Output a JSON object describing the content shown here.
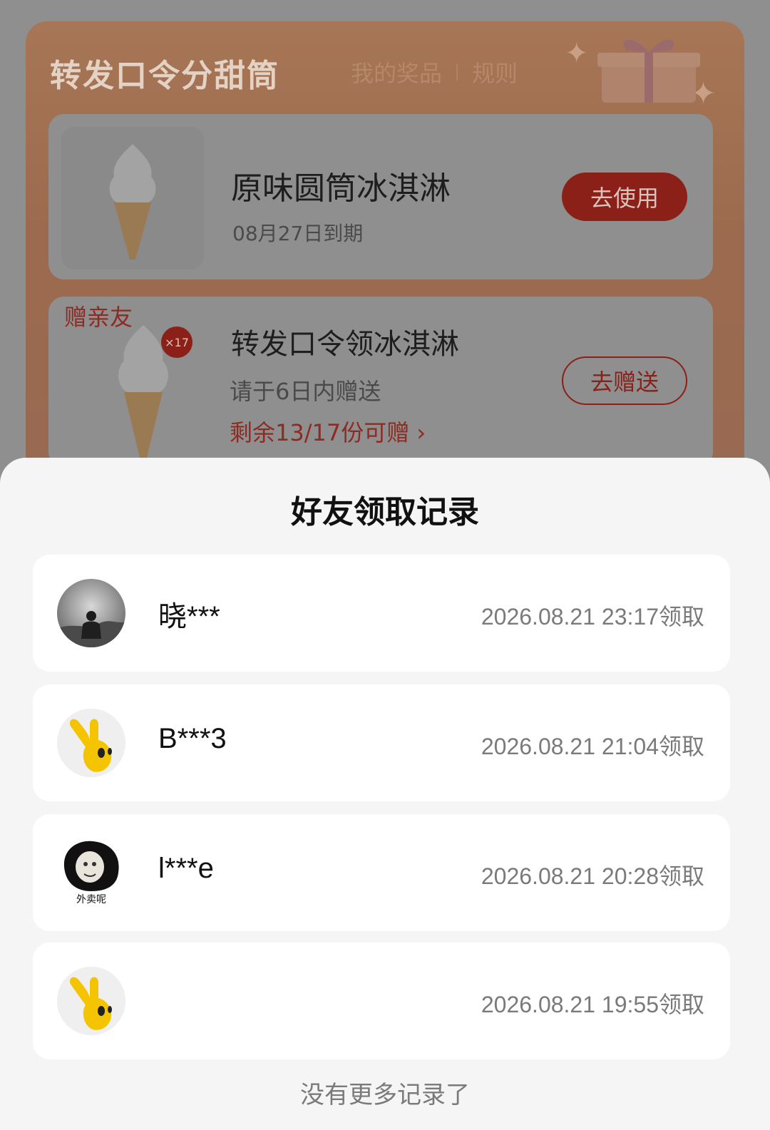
{
  "background": {
    "title": "转发口令分甜筒",
    "tabs": [
      "我的奖品",
      "规则"
    ],
    "card1": {
      "product_name": "原味圆筒冰淇淋",
      "expiry": "08月27日到期",
      "button": "去使用"
    },
    "card2": {
      "tag": "赠亲友",
      "badge": "×17",
      "product_name": "转发口令领冰淇淋",
      "subtitle": "请于6日内赠送",
      "remaining": "剩余13/17份可赠",
      "remaining_chevron": "›",
      "button": "去赠送"
    }
  },
  "sheet": {
    "title": "好友领取记录",
    "records": [
      {
        "name": "晓***",
        "time": "2026.08.21 23:17领取",
        "avatar": "landscape-photo-avatar"
      },
      {
        "name": "B***3",
        "time": "2026.08.21 21:04领取",
        "avatar": "yellow-hand-mascot-avatar"
      },
      {
        "name": "l***e",
        "time": "2026.08.21 20:28领取",
        "avatar": "meme-face-avatar"
      },
      {
        "name": "",
        "time": "2026.08.21 19:55领取",
        "avatar": "yellow-hand-mascot-avatar"
      }
    ],
    "avatar_caption": "外卖呢",
    "footer": "没有更多记录了"
  },
  "colors": {
    "accent_red": "#d6321f",
    "sheet_bg": "#f5f5f5",
    "card_bg": "#ffffff"
  }
}
